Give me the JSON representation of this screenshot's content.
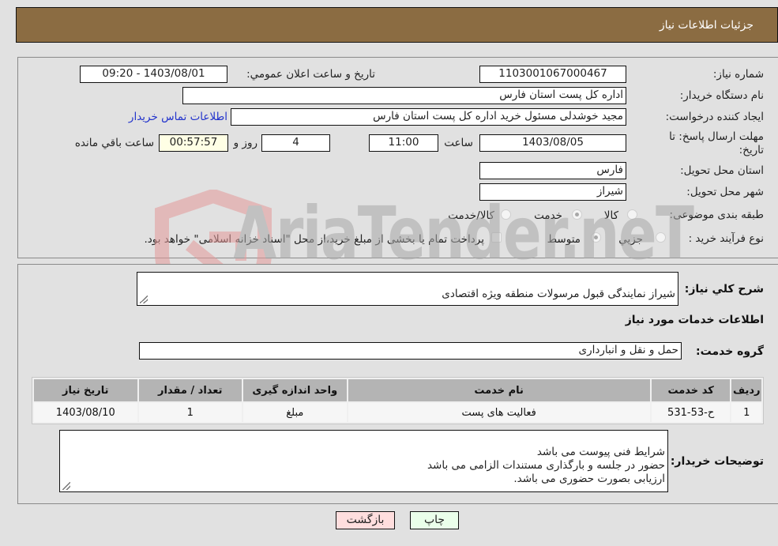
{
  "header": {
    "title": "جزئيات اطلاعات نياز"
  },
  "details": {
    "need_number_label": "شماره نياز:",
    "need_number": "1103001067000467",
    "announce_label": "تاريخ و ساعت اعلان عمومي:",
    "announce_value": "1403/08/01 - 09:20",
    "buyer_org_label": "نام دستگاه خريدار:",
    "buyer_org": "اداره کل پست استان فارس",
    "creator_label": "ايجاد کننده درخواست:",
    "creator": "مجید خوشدلی مسئول خرید اداره کل پست استان فارس",
    "buyer_contact_link": "اطلاعات تماس خريدار",
    "deadline_label": "مهلت ارسال پاسخ: تا تاريخ:",
    "deadline_date": "1403/08/05",
    "time_label": "ساعت",
    "deadline_time": "11:00",
    "days_value": "4",
    "days_label": "روز و",
    "remaining_time": "00:57:57",
    "remaining_label": "ساعت باقي مانده",
    "province_label": "استان محل تحويل:",
    "province": "فارس",
    "city_label": "شهر محل تحويل:",
    "city": "شیراز",
    "category_label": "طبقه بندی موضوعی:",
    "category_options": [
      {
        "label": "کالا",
        "selected": false
      },
      {
        "label": "خدمت",
        "selected": true
      },
      {
        "label": "کالا/خدمت",
        "selected": false
      }
    ],
    "process_label": "نوع فرآيند خريد :",
    "process_options": [
      {
        "label": "جزيي",
        "selected": false
      },
      {
        "label": "متوسط",
        "selected": true
      }
    ],
    "payment_note": "پرداخت تمام يا بخشی از مبلغ خريد،از محل \"اسناد خزانه اسلامی\" خواهد بود."
  },
  "summary": {
    "description_label": "شرح کلي نياز:",
    "description": "شیراز نمایندگی قبول مرسولات  منطقه ویژه اقتصادی",
    "services_heading": "اطلاعات خدمات مورد نياز",
    "service_group_label": "گروه خدمت:",
    "service_group": "حمل و نقل و انبارداری"
  },
  "table": {
    "columns": [
      "رديف",
      "کد خدمت",
      "نام خدمت",
      "واحد اندازه گيری",
      "تعداد / مقدار",
      "تاريخ نياز"
    ],
    "rows": [
      [
        "1",
        "ح-53-531",
        "فعالیت های پست",
        "مبلغ",
        "1",
        "1403/08/10"
      ]
    ]
  },
  "buyer_notes": {
    "label": "توضيحات خريدار:",
    "text": "شرایط فنی پیوست می باشد\nحضور در جلسه و بارگذاری مستندات الزامی می باشد\nارزیابی بصورت حضوری می باشد."
  },
  "buttons": {
    "print": "چاپ",
    "back": "بازگشت"
  },
  "watermark": {
    "text": "AriaTender.neT"
  },
  "colors": {
    "header_bg": "#8b6c42",
    "print_bg": "#eaffea",
    "back_bg": "#ffdede",
    "link": "#2233cc"
  }
}
